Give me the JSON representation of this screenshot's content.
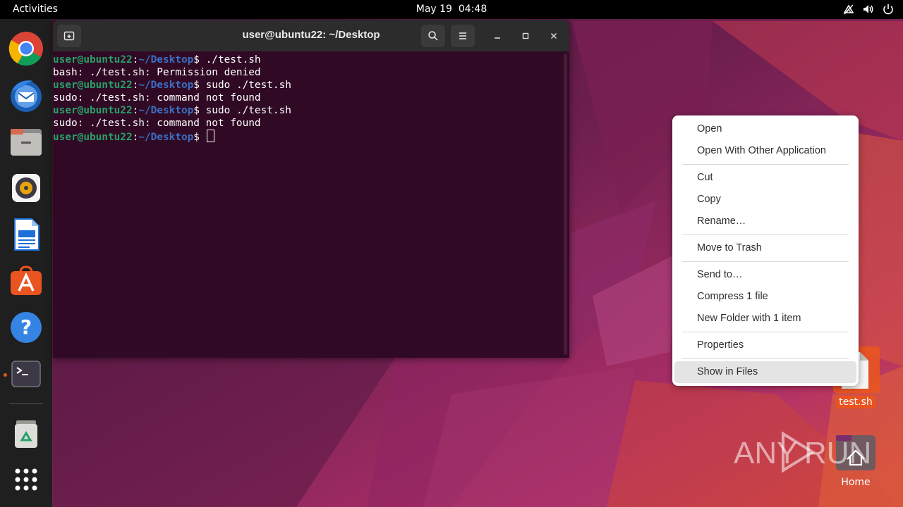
{
  "topbar": {
    "activities": "Activities",
    "date": "May 19",
    "time": "04:48",
    "tray_icons": [
      "network-icon",
      "volume-icon",
      "power-icon"
    ]
  },
  "dock": {
    "items": [
      {
        "name": "chrome",
        "icon": "chrome-icon"
      },
      {
        "name": "thunderbird",
        "icon": "thunderbird-icon"
      },
      {
        "name": "files",
        "icon": "files-icon"
      },
      {
        "name": "rhythmbox",
        "icon": "rhythmbox-icon"
      },
      {
        "name": "libreoffice-writer",
        "icon": "writer-icon"
      },
      {
        "name": "app-center",
        "icon": "app-center-icon"
      },
      {
        "name": "help",
        "icon": "help-icon"
      },
      {
        "name": "terminal",
        "icon": "terminal-icon",
        "running": true
      },
      {
        "name": "trash",
        "icon": "trash-icon"
      },
      {
        "name": "show-apps",
        "icon": "grid-icon"
      }
    ]
  },
  "terminal": {
    "title": "user@ubuntu22: ~/Desktop",
    "prompt_user": "user@ubuntu22",
    "prompt_sep": ":",
    "prompt_path": "~/Desktop",
    "prompt_dollar": "$ ",
    "lines": [
      {
        "type": "cmd",
        "text": "./test.sh"
      },
      {
        "type": "out",
        "text": "bash: ./test.sh: Permission denied"
      },
      {
        "type": "cmd",
        "text": "sudo ./test.sh"
      },
      {
        "type": "out",
        "text": "sudo: ./test.sh: command not found"
      },
      {
        "type": "cmd",
        "text": "sudo ./test.sh"
      },
      {
        "type": "out",
        "text": "sudo: ./test.sh: command not found"
      },
      {
        "type": "cmd",
        "text": ""
      }
    ]
  },
  "context_menu": {
    "items": [
      {
        "label": "Open"
      },
      {
        "label": "Open With Other Application"
      },
      {
        "label": "Cut"
      },
      {
        "label": "Copy"
      },
      {
        "label": "Rename…"
      },
      {
        "label": "Move to Trash"
      },
      {
        "label": "Send to…"
      },
      {
        "label": "Compress 1 file"
      },
      {
        "label": "New Folder with 1 item"
      },
      {
        "label": "Properties"
      },
      {
        "label": "Show in Files"
      }
    ]
  },
  "desktop": {
    "file_label": "test.sh",
    "home_label": "Home"
  },
  "watermark": "ANY RUN",
  "colors": {
    "topbar": "#000000",
    "dock": "#1f1f1f",
    "terminal_bg": "#300a24",
    "prompt_user": "#26a269",
    "prompt_path": "#3b6fc4",
    "accent": "#e95420"
  }
}
